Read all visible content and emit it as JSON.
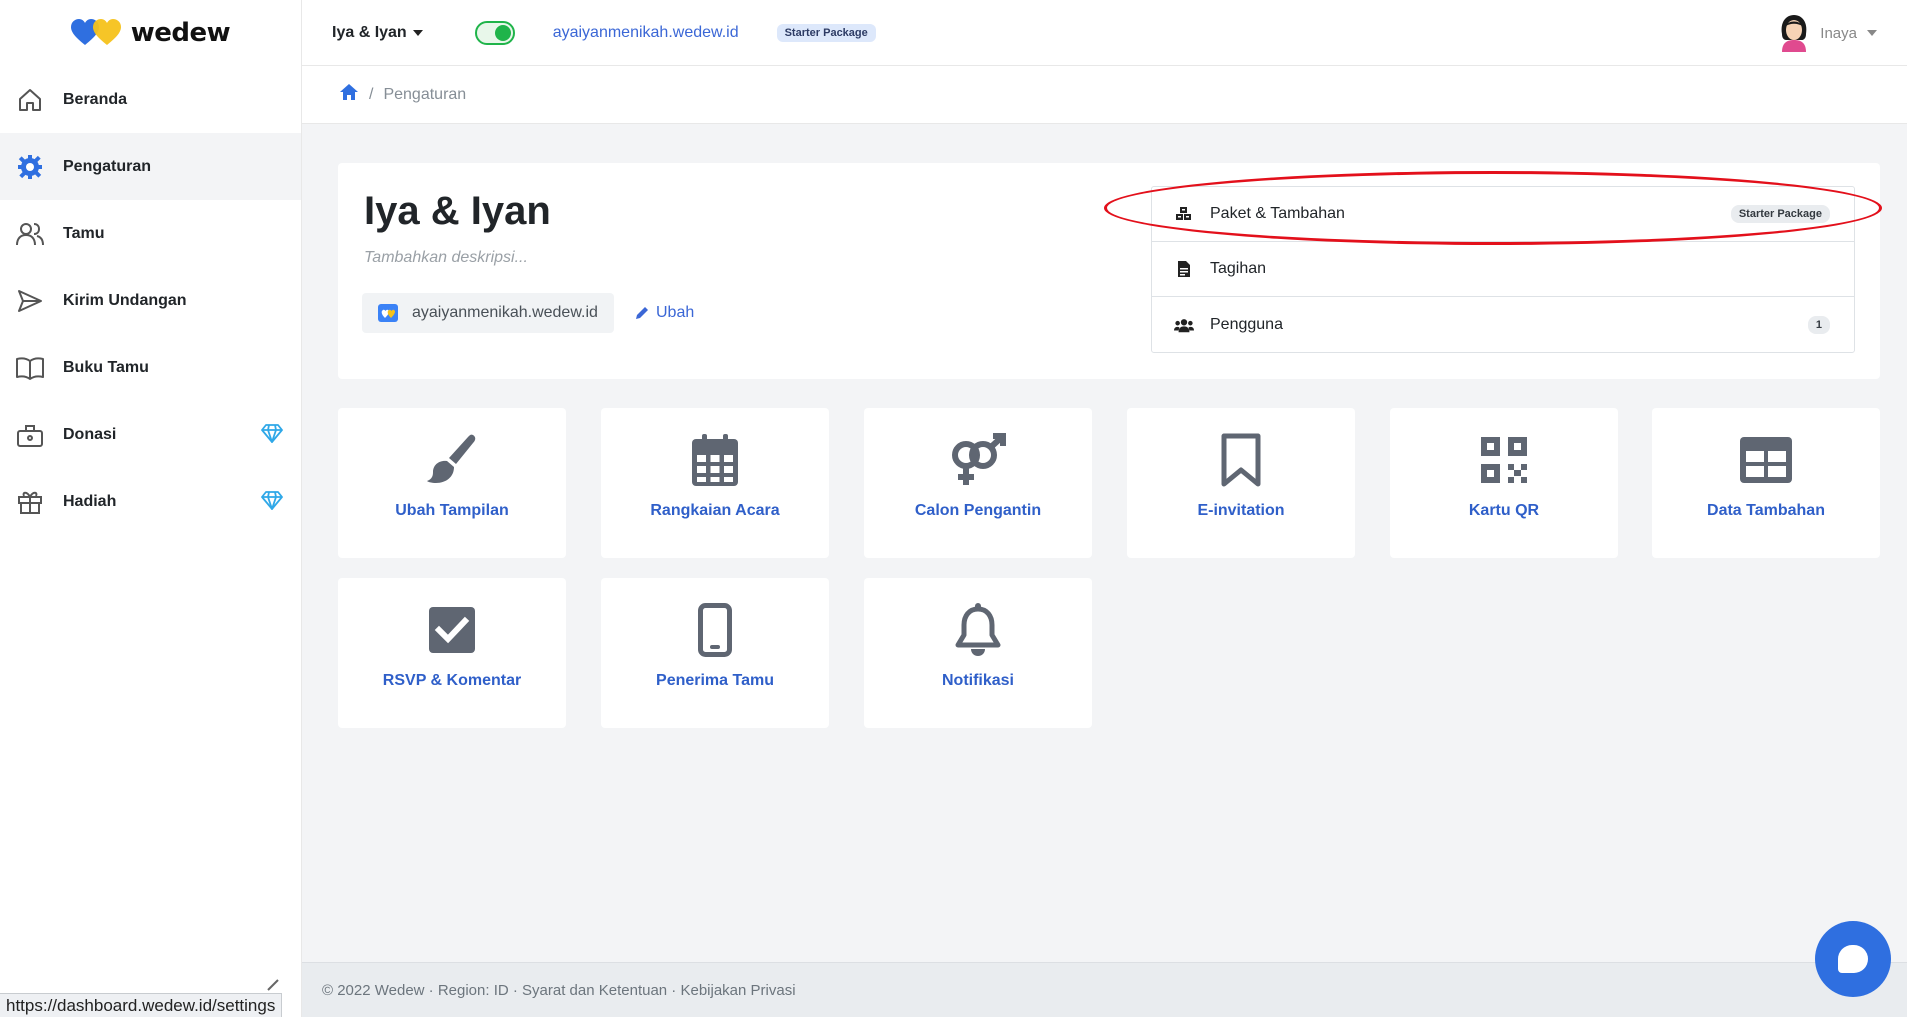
{
  "brand": {
    "name": "wedew"
  },
  "sidebar": {
    "items": [
      {
        "label": "Beranda",
        "icon": "home-icon"
      },
      {
        "label": "Pengaturan",
        "icon": "gear-icon",
        "active": true
      },
      {
        "label": "Tamu",
        "icon": "users-icon"
      },
      {
        "label": "Kirim Undangan",
        "icon": "send-icon"
      },
      {
        "label": "Buku Tamu",
        "icon": "book-icon"
      },
      {
        "label": "Donasi",
        "icon": "donation-box-icon",
        "premium": true
      },
      {
        "label": "Hadiah",
        "icon": "gift-icon",
        "premium": true
      }
    ]
  },
  "topbar": {
    "event_name": "Iya & Iyan",
    "domain": "ayaiyanmenikah.wedew.id",
    "package": "Starter Package",
    "user_name": "Inaya"
  },
  "breadcrumb": {
    "current": "Pengaturan"
  },
  "event": {
    "title": "Iya & Iyan",
    "description_placeholder": "Tambahkan deskripsi...",
    "domain": "ayaiyanmenikah.wedew.id",
    "edit_label": "Ubah"
  },
  "menu": {
    "items": [
      {
        "label": "Paket & Tambahan",
        "badge": "Starter Package",
        "icon": "boxes-icon"
      },
      {
        "label": "Tagihan",
        "icon": "invoice-icon"
      },
      {
        "label": "Pengguna",
        "badge": "1",
        "icon": "users-group-icon"
      }
    ]
  },
  "tiles": [
    {
      "label": "Ubah Tampilan",
      "icon": "paint-brush-icon"
    },
    {
      "label": "Rangkaian Acara",
      "icon": "calendar-icon"
    },
    {
      "label": "Calon Pengantin",
      "icon": "gender-icon"
    },
    {
      "label": "E-invitation",
      "icon": "bookmark-icon"
    },
    {
      "label": "Kartu QR",
      "icon": "qr-code-icon"
    },
    {
      "label": "Data Tambahan",
      "icon": "table-icon"
    },
    {
      "label": "RSVP & Komentar",
      "icon": "check-square-icon"
    },
    {
      "label": "Penerima Tamu",
      "icon": "mobile-icon"
    },
    {
      "label": "Notifikasi",
      "icon": "bell-icon"
    }
  ],
  "footer": {
    "text": "© 2022 Wedew · Region: ID · Syarat dan Ketentuan · Kebijakan Privasi"
  },
  "status_bar": {
    "url": "https://dashboard.wedew.id/settings"
  },
  "colors": {
    "accent": "#2f5fc9",
    "active_toggle": "#1fb44a",
    "highlight": "#e3101b",
    "premium": "#2fa8e8"
  }
}
